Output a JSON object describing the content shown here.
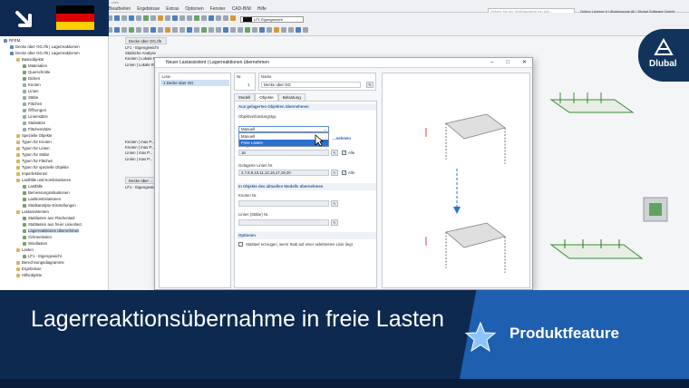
{
  "app": {
    "window_title": "...mes",
    "menus": [
      "Bearbeiten",
      "Ergebnisse",
      "Extras",
      "Optionen",
      "Fenster",
      "CAD-BIM",
      "Hilfe"
    ],
    "search_placeholder": "Geben Sie ein Schlüsselwort ein (Alt...",
    "license": "Online License 6 | Abdulrazzak Ali | Dlubal Software GmbH",
    "loadcase_combo": "LF1   Eigengewicht",
    "brand": "Dlubal"
  },
  "navigator": {
    "items": [
      {
        "label": "RFEM",
        "indent": 0,
        "icon": "blue"
      },
      {
        "label": "Decke über OG.rf6 | Lagerreaktionen",
        "indent": 1,
        "icon": "blue"
      },
      {
        "label": "Decke über OG.rf6 | Lagerreaktionen",
        "indent": 1,
        "icon": "blue"
      },
      {
        "label": "Basisobjekte",
        "indent": 2,
        "icon": "folder"
      },
      {
        "label": "Materialien",
        "indent": 3,
        "icon": "gr"
      },
      {
        "label": "Querschnitte",
        "indent": 3,
        "icon": "gr"
      },
      {
        "label": "Dicken",
        "indent": 3,
        "icon": "gr"
      },
      {
        "label": "Knoten",
        "indent": 3,
        "icon": "gray"
      },
      {
        "label": "Linien",
        "indent": 3,
        "icon": "gray"
      },
      {
        "label": "Stäbe",
        "indent": 3,
        "icon": "gray"
      },
      {
        "label": "Flächen",
        "indent": 3,
        "icon": "gray"
      },
      {
        "label": "Öffnungen",
        "indent": 3,
        "icon": "gray"
      },
      {
        "label": "Liniensätze",
        "indent": 3,
        "icon": "gray"
      },
      {
        "label": "Stabsätze",
        "indent": 3,
        "icon": "gray"
      },
      {
        "label": "Flächensätze",
        "indent": 3,
        "icon": "gray"
      },
      {
        "label": "Spezielle Objekte",
        "indent": 2,
        "icon": "folder"
      },
      {
        "label": "Typen für Knoten",
        "indent": 2,
        "icon": "folder"
      },
      {
        "label": "Typen für Linien",
        "indent": 2,
        "icon": "folder"
      },
      {
        "label": "Typen für Stäbe",
        "indent": 2,
        "icon": "folder"
      },
      {
        "label": "Typen für Flächen",
        "indent": 2,
        "icon": "folder"
      },
      {
        "label": "Typen für spezielle Objekte",
        "indent": 2,
        "icon": "folder"
      },
      {
        "label": "Imperfektionen",
        "indent": 2,
        "icon": "folder"
      },
      {
        "label": "Lastfälle und Kombinationen",
        "indent": 2,
        "icon": "folder"
      },
      {
        "label": "Lastfälle",
        "indent": 3,
        "icon": "gr"
      },
      {
        "label": "Bemessungssituationen",
        "indent": 3,
        "icon": "gr"
      },
      {
        "label": "Lastkombinationen",
        "indent": 3,
        "icon": "gr"
      },
      {
        "label": "Statikanalyse-Einstellungen",
        "indent": 3,
        "icon": "gr"
      },
      {
        "label": "Lastassistenten",
        "indent": 2,
        "icon": "folder"
      },
      {
        "label": "Stablasten aus Flächenlast",
        "indent": 3,
        "icon": "gr"
      },
      {
        "label": "Stablasten aus freier Linienlast",
        "indent": 3,
        "icon": "gr"
      },
      {
        "label": "Lagerreaktionen übernehmen",
        "indent": 3,
        "icon": "gr",
        "selected": true
      },
      {
        "label": "Schneelasten",
        "indent": 3,
        "icon": "gr"
      },
      {
        "label": "Windlasten",
        "indent": 3,
        "icon": "gr"
      },
      {
        "label": "Lasten",
        "indent": 2,
        "icon": "folder"
      },
      {
        "label": "LF1 - Eigengewicht",
        "indent": 3,
        "icon": "gr"
      },
      {
        "label": "Berechnungsdiagramme",
        "indent": 2,
        "icon": "folder"
      },
      {
        "label": "Ergebnisse",
        "indent": 2,
        "icon": "folder"
      },
      {
        "label": "Hilfsobjekte",
        "indent": 2,
        "icon": "folder"
      }
    ]
  },
  "viewport_top": {
    "header": "Decke über OG.rf6",
    "lines": [
      "LF1 - Eigengewicht",
      "Statische Analyse",
      "Knoten | Lokale Re...",
      "Linien | Lokale Re..."
    ]
  },
  "viewport_mid": {
    "lines": [
      "Knoten | max P...",
      "Knoten | max P...",
      "Linien | max P...",
      "Linien | max P..."
    ]
  },
  "viewport_bottom": {
    "header": "Decke über ...",
    "lines": [
      "LF1 - Eigengewicht"
    ]
  },
  "dialog": {
    "title": "Neuer Lastassistent | Lagerreaktionen übernehmen",
    "list_header": "Liste",
    "list_item": "1   Decke über OG",
    "nr_label": "Nr.",
    "nr_value": "1",
    "name_label": "Name",
    "name_value": "Decke über OG",
    "tabs": [
      "Modell",
      "Objekte",
      "Belastung"
    ],
    "active_tab": "Objekte",
    "section1": "Aus gelagerten Objekten übernehmen",
    "objekttyp_label": "Objektverbindungstyp",
    "dropdown_value": "Manuell",
    "dropdown_options": [
      "Manuell",
      "Freie Lasten"
    ],
    "highlighted_option": "Freie Lasten",
    "section1_suffix": "...nehmen",
    "knoten_label": "Gelagerte Knoten Nr.",
    "knoten_value": "16",
    "alle_label": "Alle",
    "linien_label": "Gelagerte Linien Nr.",
    "linien_value": "2,7,8,9,10,11,12,16,17,19,20",
    "section2": "In Objekte des aktuellen Modells übernehmen",
    "knoten2_label": "Knoten Nr.",
    "linien2_label": "Linien (Stäbe) Nr.",
    "options_label": "Optionen",
    "option_text": "Stablast erzeugen, wenn Stab auf einer selektierten Linie liegt"
  },
  "banner": {
    "title": "Lagerreaktionsübernahme in freie Lasten",
    "badge": "Produktfeature"
  },
  "colors": {
    "banner_bg": "#0e2950",
    "accent_blue": "#1f5fb0",
    "highlight": "#2c6fcf"
  }
}
